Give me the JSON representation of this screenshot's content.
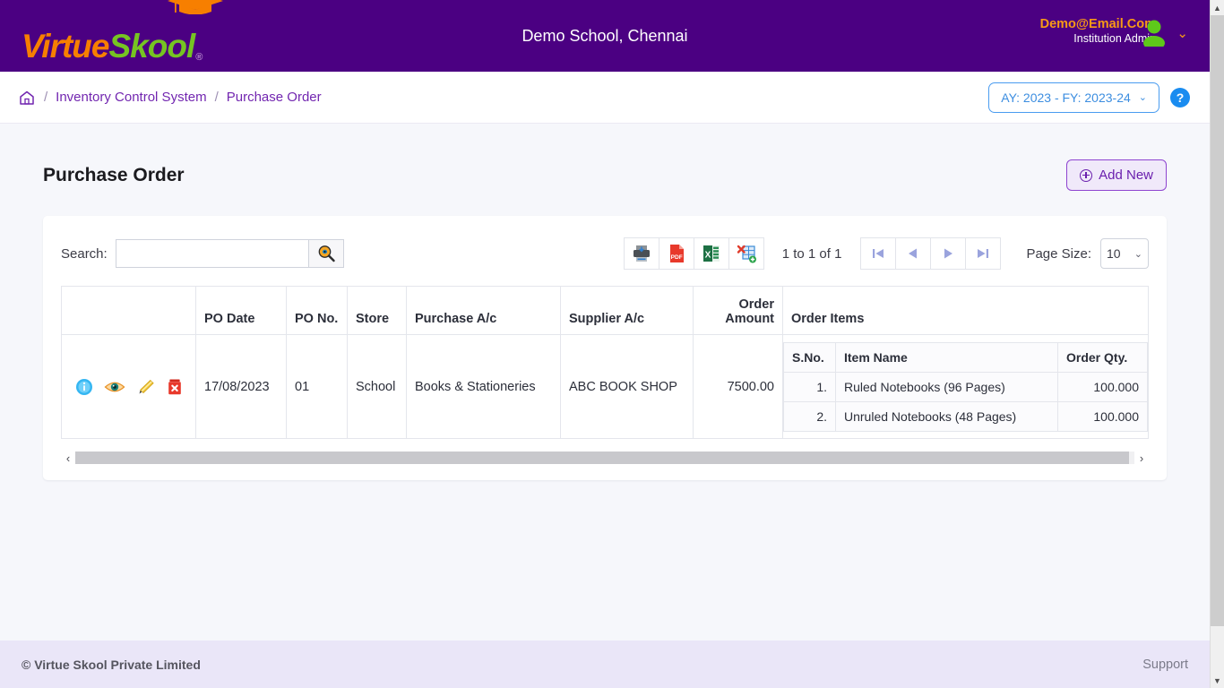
{
  "header": {
    "logo_virtue": "Virtue",
    "logo_skool": "Skool",
    "logo_reg": "®",
    "school_title": "Demo School, Chennai",
    "account_email": "Demo@Email.Com",
    "account_role": "Institution Admin",
    "caret": "⌄"
  },
  "breadcrumb": {
    "home_icon": "home-icon",
    "sep": "/",
    "items": [
      {
        "label": "Inventory Control System"
      },
      {
        "label": "Purchase Order"
      }
    ],
    "ay_selector": "AY: 2023 - FY: 2023-24",
    "ay_chevron": "⌄",
    "help_label": "?"
  },
  "page": {
    "title": "Purchase Order",
    "add_new_label": "Add New"
  },
  "toolbar": {
    "search_label": "Search:",
    "search_value": "",
    "search_placeholder": "",
    "search_button_icon": "magnifier-icon",
    "export_buttons": [
      {
        "name": "print-export",
        "icon": "printer-icon"
      },
      {
        "name": "pdf-export",
        "icon": "pdf-icon"
      },
      {
        "name": "excel-export",
        "icon": "excel-icon"
      },
      {
        "name": "xml-export",
        "icon": "xml-grid-icon"
      }
    ],
    "record_count": "1 to 1 of 1",
    "pager": [
      {
        "name": "first-page",
        "glyph": "⏮"
      },
      {
        "name": "prev-page",
        "glyph": "◀"
      },
      {
        "name": "next-page",
        "glyph": "▶"
      },
      {
        "name": "last-page",
        "glyph": "⏭"
      }
    ],
    "page_size_label": "Page Size:",
    "page_size_value": "10",
    "page_size_chevron": "⌄"
  },
  "table": {
    "columns": [
      {
        "key": "actions",
        "label": ""
      },
      {
        "key": "po_date",
        "label": "PO Date"
      },
      {
        "key": "po_no",
        "label": "PO No."
      },
      {
        "key": "store",
        "label": "Store"
      },
      {
        "key": "purchase_ac",
        "label": "Purchase A/c"
      },
      {
        "key": "supplier_ac",
        "label": "Supplier A/c"
      },
      {
        "key": "order_amount",
        "label": "Order Amount"
      },
      {
        "key": "order_items",
        "label": "Order Items"
      }
    ],
    "rows": [
      {
        "actions": [
          {
            "name": "info-action",
            "icon": "info-circle-icon"
          },
          {
            "name": "view-action",
            "icon": "eye-icon"
          },
          {
            "name": "edit-action",
            "icon": "pencil-icon"
          },
          {
            "name": "delete-action",
            "icon": "trash-delete-icon"
          }
        ],
        "po_date": "17/08/2023",
        "po_no": "01",
        "store": "School",
        "purchase_ac": "Books & Stationeries",
        "supplier_ac": "ABC BOOK SHOP",
        "order_amount": "7500.00",
        "order_items": {
          "columns": [
            {
              "key": "sno",
              "label": "S.No."
            },
            {
              "key": "item_name",
              "label": "Item Name"
            },
            {
              "key": "order_qty",
              "label": "Order Qty."
            }
          ],
          "rows": [
            {
              "sno": "1.",
              "item_name": "Ruled Notebooks (96 Pages)",
              "order_qty": "100.000"
            },
            {
              "sno": "2.",
              "item_name": "Unruled Notebooks (48 Pages)",
              "order_qty": "100.000"
            }
          ]
        }
      }
    ],
    "hscroll_left": "‹",
    "hscroll_right": "›"
  },
  "footer": {
    "copyright": "© Virtue Skool Private Limited",
    "support_label": "Support"
  },
  "scrollbar": {
    "up_arrow": "▲",
    "down_arrow": "▼"
  },
  "colors": {
    "brand_purple": "#4B0082",
    "brand_orange": "#F77F00",
    "brand_green": "#76C422",
    "accent_blue": "#1A8CF0",
    "link_purple": "#7226B0"
  }
}
